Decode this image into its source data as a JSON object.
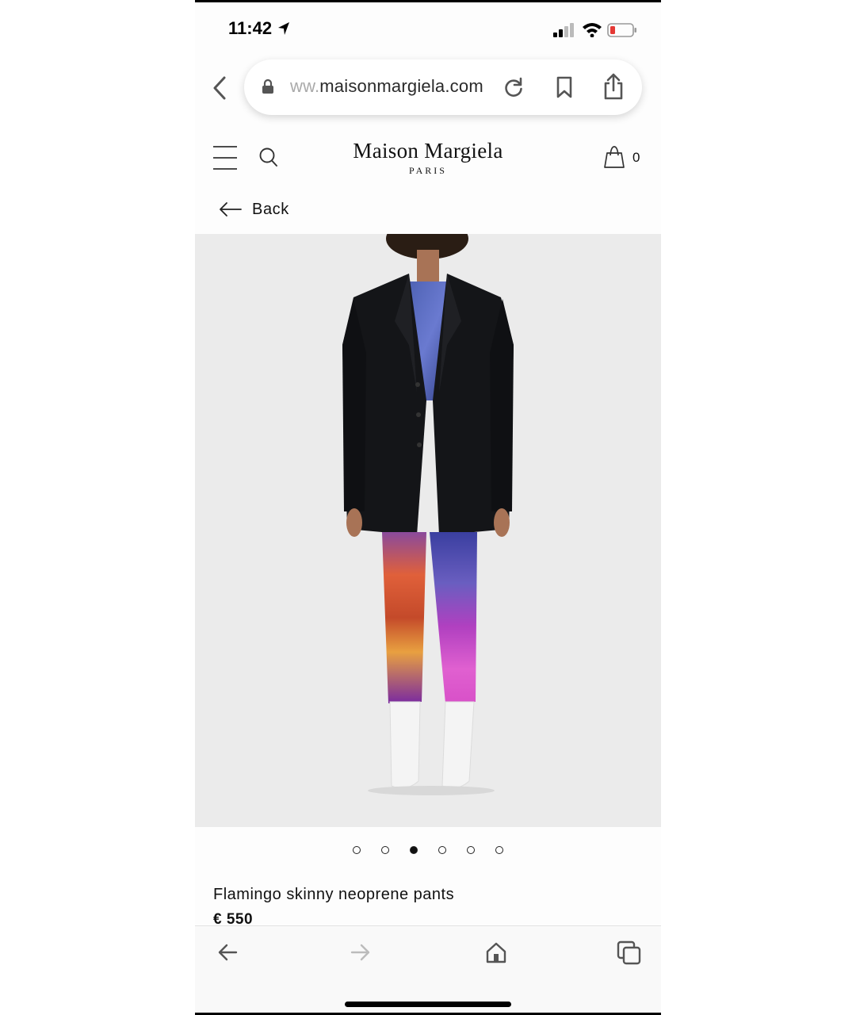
{
  "status_bar": {
    "time": "11:42",
    "icons": [
      "location-arrow-icon",
      "cellular-signal-icon",
      "wifi-icon",
      "battery-low-icon"
    ]
  },
  "browser": {
    "url_faded": "ww.",
    "url_main": "maisonmargiela.com",
    "icons": [
      "back-chevron-icon",
      "lock-icon",
      "reload-icon",
      "bookmark-icon",
      "share-icon"
    ]
  },
  "header": {
    "logo_main": "Maison Margiela",
    "logo_sub": "PARIS",
    "cart_count": "0",
    "icons": [
      "hamburger-menu-icon",
      "search-icon",
      "shopping-bag-icon"
    ]
  },
  "nav": {
    "back_label": "Back"
  },
  "gallery": {
    "image_count": 6,
    "active_index": 2
  },
  "product": {
    "name": "Flamingo skinny neoprene pants",
    "price": "€ 550"
  },
  "toolbar": {
    "icons": [
      "back-arrow-icon",
      "forward-arrow-icon",
      "home-icon",
      "tabs-icon"
    ]
  },
  "colors": {
    "image_background": "#ebebeb",
    "battery_low": "#e53935",
    "text": "#111111"
  }
}
